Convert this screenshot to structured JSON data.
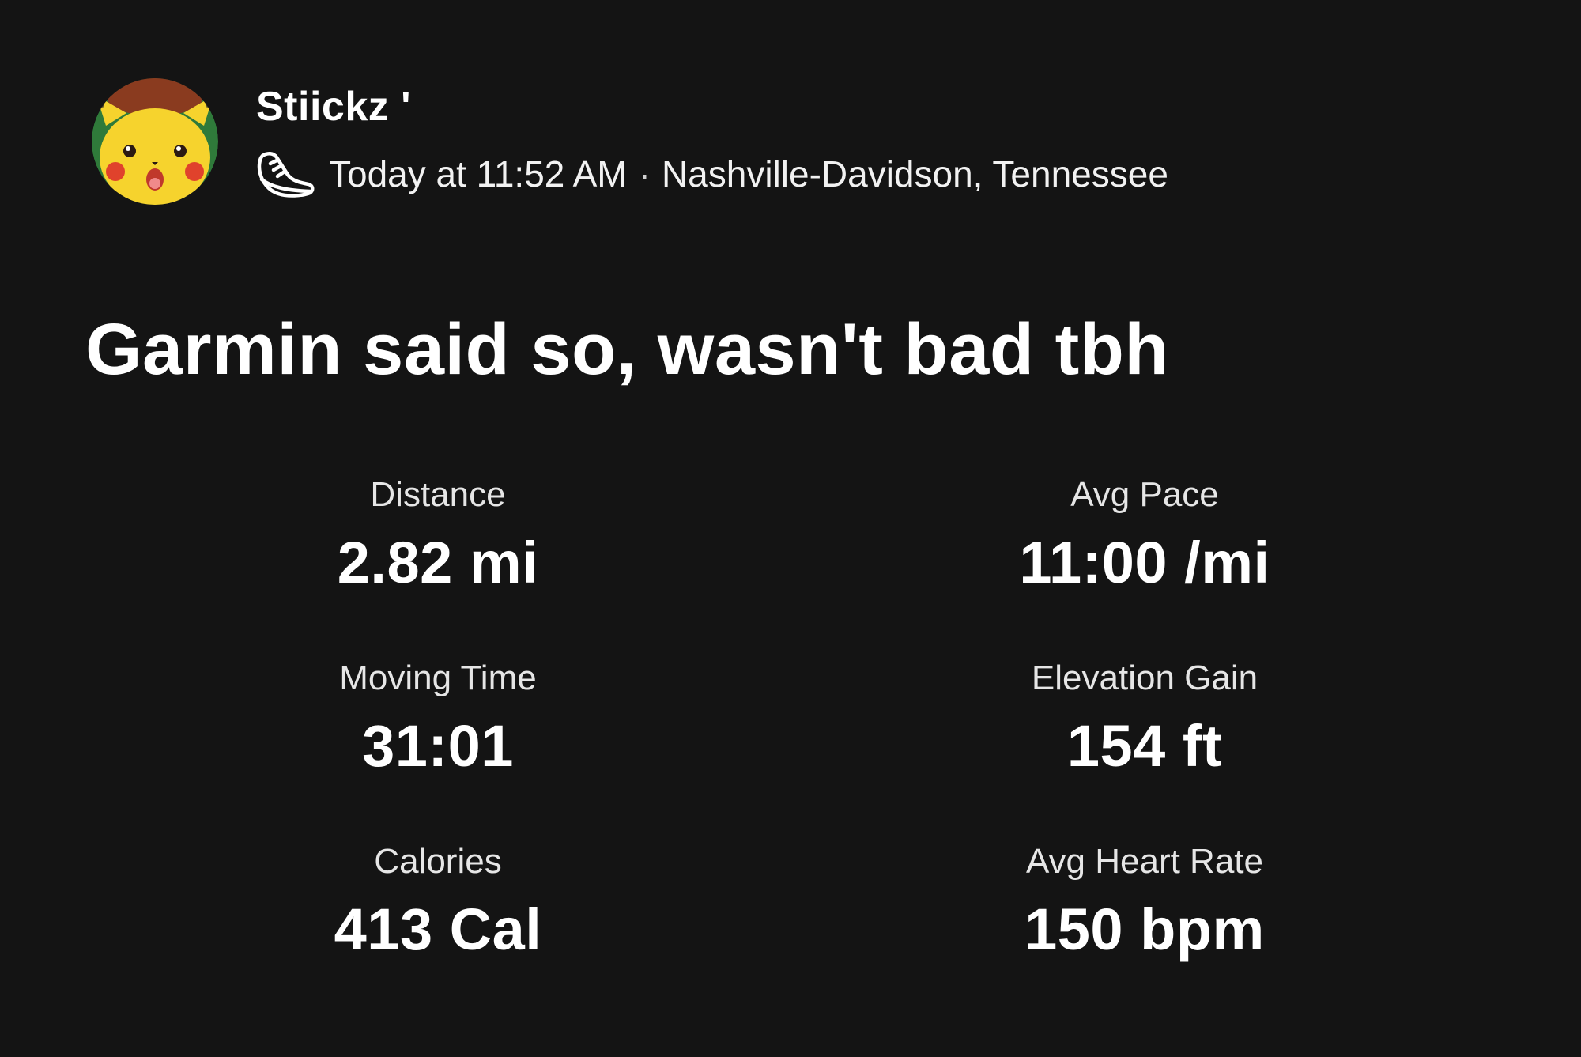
{
  "activity": {
    "athlete": {
      "name": "Stiickz '",
      "avatar_icon": "pikachu-avatar-icon"
    },
    "activity_icon": "running-shoe-icon",
    "timestamp": "Today at 11:52 AM",
    "separator": "·",
    "location": "Nashville-Davidson, Tennessee",
    "title": "Garmin said so, wasn't bad tbh"
  },
  "stats": [
    {
      "label": "Distance",
      "value": "2.82 mi"
    },
    {
      "label": "Avg Pace",
      "value": "11:00 /mi"
    },
    {
      "label": "Moving Time",
      "value": "31:01"
    },
    {
      "label": "Elevation Gain",
      "value": "154 ft"
    },
    {
      "label": "Calories",
      "value": "413 Cal"
    },
    {
      "label": "Avg Heart Rate",
      "value": "150 bpm"
    }
  ],
  "colors": {
    "background": "#141414",
    "text_primary": "#ffffff",
    "text_secondary": "#e6e6e6"
  }
}
